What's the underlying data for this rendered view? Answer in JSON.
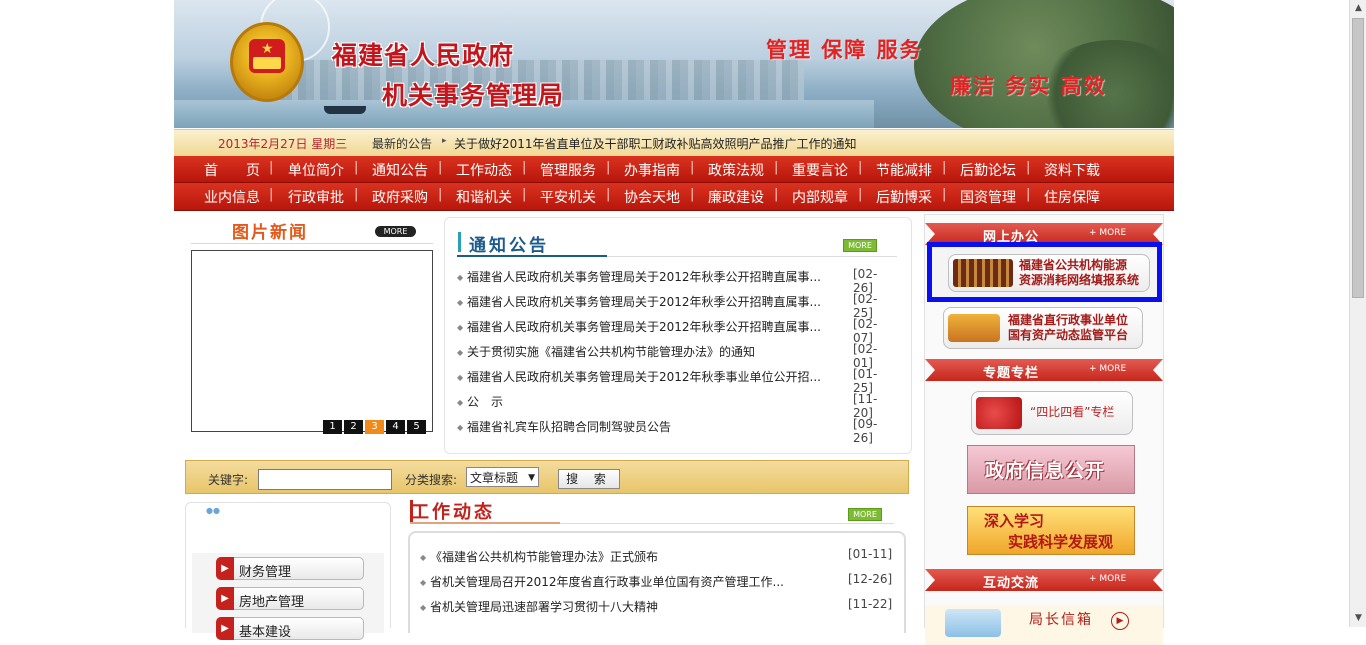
{
  "header": {
    "org_line1": "福建省人民政府",
    "org_line2": "机关事务管理局",
    "slogan1": "管理 保障 服务",
    "slogan2": "廉洁 务实 高效"
  },
  "datebar": {
    "date": "2013年2月27日 星期三",
    "latest_label": "最新的公告",
    "latest_news": "关于做好2011年省直单位及干部职工财政补贴高效照明产品推广工作的通知"
  },
  "nav_row1": [
    "首　　页",
    "单位简介",
    "通知公告",
    "工作动态",
    "管理服务",
    "办事指南",
    "政策法规",
    "重要言论",
    "节能减排",
    "后勤论坛",
    "资料下载"
  ],
  "nav_row2": [
    "业内信息",
    "行政审批",
    "政府采购",
    "和谐机关",
    "平安机关",
    "协会天地",
    "廉政建设",
    "内部规章",
    "后勤博采",
    "国资管理",
    "住房保障"
  ],
  "pic_news": {
    "title": "图片新闻",
    "more": "MORE",
    "pages": [
      "1",
      "2",
      "3",
      "4",
      "5"
    ],
    "active_page": "3"
  },
  "notice": {
    "title": "通知公告",
    "more": "MORE",
    "items": [
      {
        "text": "福建省人民政府机关事务管理局关于2012年秋季公开招聘直属事...",
        "date": "[02-26]"
      },
      {
        "text": "福建省人民政府机关事务管理局关于2012年秋季公开招聘直属事...",
        "date": "[02-25]"
      },
      {
        "text": "福建省人民政府机关事务管理局关于2012年秋季公开招聘直属事...",
        "date": "[02-07]"
      },
      {
        "text": "关于贯彻实施《福建省公共机构节能管理办法》的通知",
        "date": "[02-01]"
      },
      {
        "text": "福建省人民政府机关事务管理局关于2012年秋季事业单位公开招...",
        "date": "[01-25]"
      },
      {
        "text": "公　示",
        "date": "[11-20]"
      },
      {
        "text": "福建省礼宾车队招聘合同制驾驶员公告",
        "date": "[09-26]"
      }
    ]
  },
  "search": {
    "keyword_label": "关键字:",
    "keyword_value": "",
    "category_label": "分类搜索:",
    "category_selected": "文章标题",
    "button": "搜 索"
  },
  "categories": [
    "财务管理",
    "房地产管理",
    "基本建设"
  ],
  "work": {
    "title": "工作动态",
    "more": "MORE",
    "items": [
      {
        "text": "《福建省公共机构节能管理办法》正式颁布",
        "date": "[01-11]"
      },
      {
        "text": "省机关管理局召开2012年度省直行政事业单位国有资产管理工作...",
        "date": "[12-26]"
      },
      {
        "text": "省机关管理局迅速部署学习贯彻十八大精神",
        "date": "[11-22]"
      }
    ]
  },
  "right": {
    "online_title": "网上办公",
    "online_more": "+ MORE",
    "energy_line1": "福建省公共机构能源",
    "energy_line2": "资源消耗网络填报系统",
    "asset_line1": "福建省直行政事业单位",
    "asset_line2": "国有资产动态监管平台",
    "special_title": "专题专栏",
    "special_more": "+ MORE",
    "special_btn": "“四比四看”专栏",
    "gov_open": "政府信息公开",
    "study_line1": "深入学习",
    "study_line2": "实践科学发展观",
    "interact_title": "互动交流",
    "interact_more": "+ MORE",
    "mailbox": "局长信箱"
  },
  "colors": {
    "nav_red": "#c4200f",
    "highlight_blue": "#0a0ff0",
    "title_red": "#c2161c",
    "notice_blue": "#1c5a8c"
  }
}
